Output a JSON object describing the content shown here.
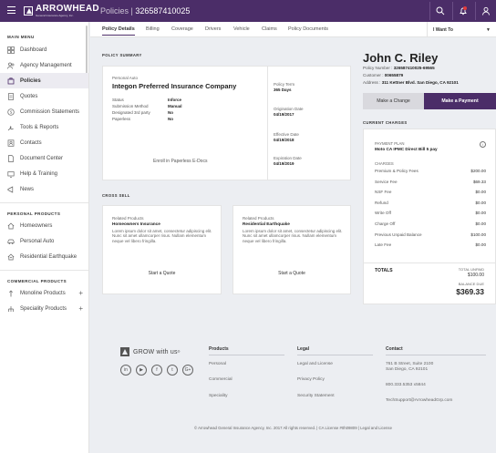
{
  "header": {
    "brand": "ARROWHEAD",
    "brand_sub": "General Insurance Agency, Inc.",
    "section": "Policies",
    "separator": " | ",
    "policy_number": "326587410025"
  },
  "sidebar": {
    "main_menu_title": "MAIN MENU",
    "items": [
      {
        "label": "Dashboard",
        "icon": "dashboard-icon"
      },
      {
        "label": "Agency Management",
        "icon": "agency-icon"
      },
      {
        "label": "Policies",
        "icon": "policies-icon"
      },
      {
        "label": "Quotes",
        "icon": "quotes-icon"
      },
      {
        "label": "Commission Statements",
        "icon": "commission-icon"
      },
      {
        "label": "Tools & Reports",
        "icon": "tools-icon"
      },
      {
        "label": "Contacts",
        "icon": "contacts-icon"
      },
      {
        "label": "Document Center",
        "icon": "document-icon"
      },
      {
        "label": "Help & Training",
        "icon": "help-icon"
      },
      {
        "label": "News",
        "icon": "news-icon"
      }
    ],
    "personal_title": "PERSONAL PRODUCTS",
    "personal": [
      {
        "label": "Homeowners",
        "icon": "home-icon"
      },
      {
        "label": "Personal Auto",
        "icon": "car-icon"
      },
      {
        "label": "Residential Earthquake",
        "icon": "earthquake-icon"
      }
    ],
    "commercial_title": "COMMERCIAL PRODUCTS",
    "commercial": [
      {
        "label": "Monoline Products",
        "icon": "monoline-icon"
      },
      {
        "label": "Speciality Products",
        "icon": "speciality-icon"
      }
    ]
  },
  "tabs": [
    "Policy Details",
    "Billing",
    "Coverage",
    "Drivers",
    "Vehicle",
    "Claims",
    "Policy Documents"
  ],
  "i_want_to": "I Want To",
  "policy_summary": {
    "section_title": "POLICY SUMMARY",
    "product": "Personal Auto",
    "company": "Integon Preferred Insurance Company",
    "details": [
      {
        "k": "Status",
        "v": "Inforce"
      },
      {
        "k": "Submission Method",
        "v": "Manual"
      },
      {
        "k": "Designated 3rd party",
        "v": "No"
      },
      {
        "k": "Paperless",
        "v": "No"
      }
    ],
    "enroll_link": "Enroll in Paperless E-Docs",
    "right": [
      {
        "k": "Policy Term",
        "v": "365 Days"
      },
      {
        "k": "Origination Date",
        "v": "04/19/2017"
      },
      {
        "k": "Effective Date",
        "v": "04/19/2018"
      },
      {
        "k": "Expiration Date",
        "v": "04/19/2019"
      }
    ]
  },
  "cross_sell": {
    "section_title": "CROSS SELL",
    "cards": [
      {
        "label": "Related Products",
        "title": "Homeowners Insurance",
        "text": "Lorem ipsum dolor sit amet, consectetur adipiscing elit. Nunc sit amet ullamcorper risus. Nullam elementum neque vel libero fringilla.",
        "cta": "Start a Quote"
      },
      {
        "label": "Related Products",
        "title": "Residential Earthquake",
        "text": "Lorem ipsum dolor sit amet, consectetur adipiscing elit. Nunc sit amet ullamcorper risus. Nullam elementum neque vel libero fringilla.",
        "cta": "Start a Quote"
      }
    ]
  },
  "customer": {
    "name": "John C. Riley",
    "policy_label": "Policy Number : ",
    "policy_number": "326587410025-69565",
    "customer_label": "Customer : ",
    "customer_number": "00655879",
    "address_label": "Address : ",
    "address": "311 Kettner Blvd. San Diego, CA 92101"
  },
  "buttons": {
    "change": "Make a Change",
    "pay": "Make a Payment"
  },
  "charges": {
    "section_title": "CURRENT CHARGES",
    "plan_label": "PAYMENT PLAN",
    "plan": "Moto CA IPMC Direct Bill 5 pay",
    "charges_label": "CHARGES",
    "items": [
      {
        "k": "Premium & Policy Fees",
        "v": "$200.00"
      },
      {
        "k": "Service Fee",
        "v": "$69.33"
      },
      {
        "k": "NSF Fee",
        "v": "$0.00"
      },
      {
        "k": "Refund",
        "v": "$0.00"
      },
      {
        "k": "Write Off",
        "v": "$0.00"
      },
      {
        "k": "Charge Off",
        "v": "$0.00"
      },
      {
        "k": "Previous Unpaid Balance",
        "v": "$100.00"
      },
      {
        "k": "Late Fee",
        "v": "$0.00"
      }
    ],
    "totals_label": "TOTALS",
    "total_unpaid_label": "TOTAL UNPAID",
    "total_unpaid": "$100.00",
    "balance_due_label": "BALANCE DUE",
    "balance_due": "$369.33"
  },
  "footer": {
    "grow": "GROW with us",
    "grow_sup": "®",
    "social": [
      "in",
      "▶",
      "f",
      "t",
      "G+"
    ],
    "products_title": "Products",
    "products": [
      "Personal",
      "Commercial",
      "Speciality"
    ],
    "legal_title": "Legal",
    "legal": [
      "Legal and License",
      "Privacy Policy",
      "Security Statement"
    ],
    "contact_title": "Contact",
    "address1": "761 B Street, Suite 2100",
    "address2": "San Diego, CA 92101",
    "phone": "800.333.5353 x5844",
    "email": "TechSupport@ArrowheadGrp.com",
    "copyright": "© Arrowhead General Insurance Agency, Inc. 2017 All rights reserved.  |  CA License #0h09809  |  Legal and License"
  }
}
